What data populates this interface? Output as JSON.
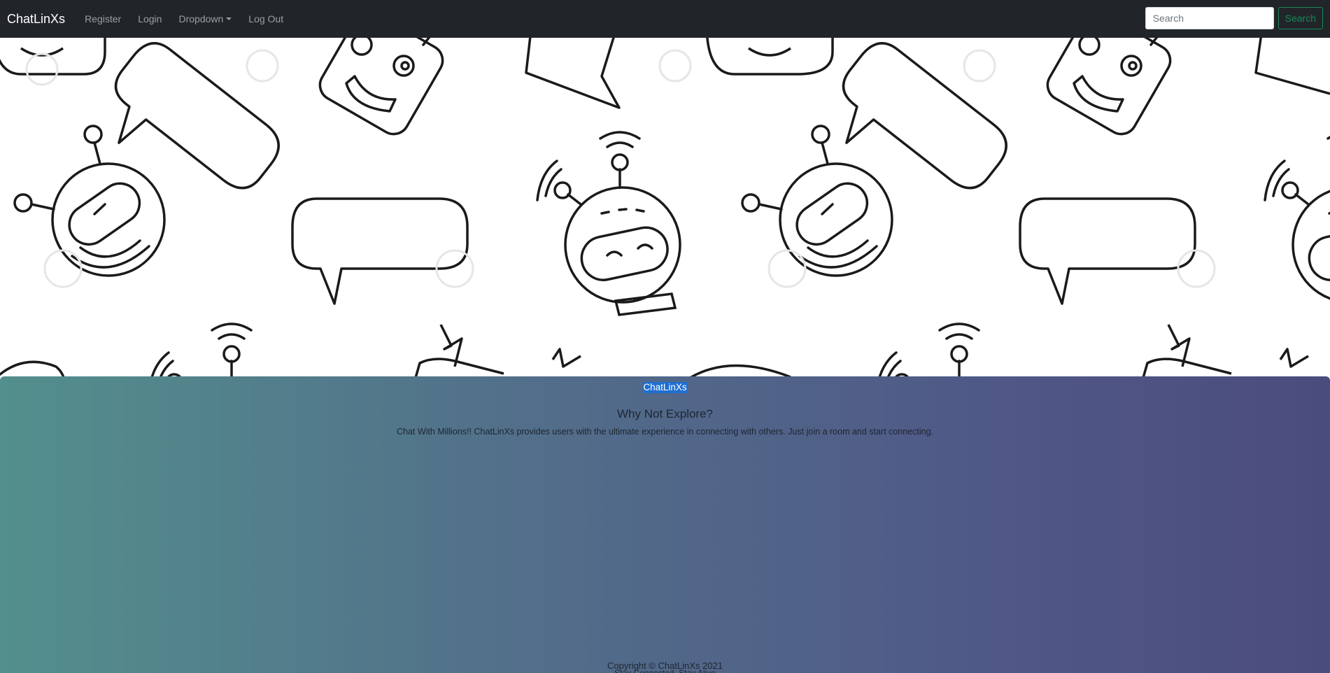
{
  "navbar": {
    "brand": "ChatLinXs",
    "links": [
      "Register",
      "Login",
      "Dropdown",
      "Log Out"
    ],
    "search_placeholder": "Search",
    "search_button": "Search"
  },
  "hero": {
    "icons": [
      "chat-bubble-icon",
      "robot-head-icon",
      "robot-antenna-icon"
    ]
  },
  "jumbotron": {
    "badge": "ChatLinXs",
    "headline": "Why Not Explore?",
    "lead": "Chat With Millions!! ChatLinXs provides users with the ultimate experience in connecting with others. Just join a room and start connecting.",
    "copyright": "Copyright © ChatLinXs 2021",
    "subline": "Stay Connected. Stay Alive"
  },
  "colors": {
    "navbar": "#212529",
    "search_button": "#198754",
    "gradient_start": "#538f8c",
    "gradient_end": "#4b4c7e",
    "highlight": "#1f6fd1"
  }
}
